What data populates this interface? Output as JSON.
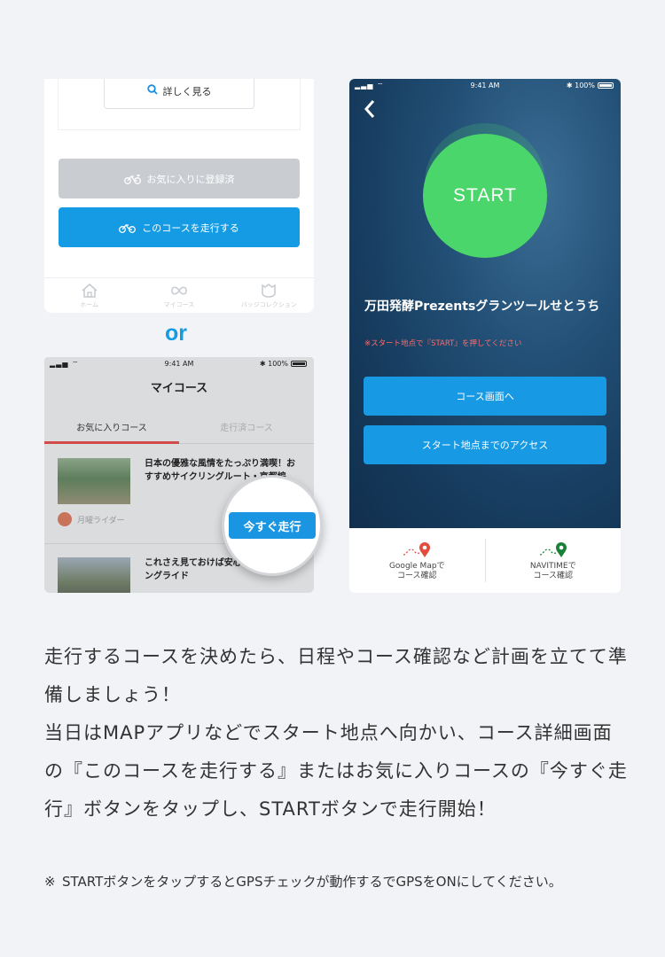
{
  "panel_a": {
    "detail_button": "詳しく見る",
    "fav_button": "お気に入りに登録済",
    "run_button": "このコースを走行する",
    "tabs": [
      "ホーム",
      "マイコース",
      "バッジコレクション"
    ]
  },
  "or_label": "or",
  "panel_b": {
    "status": {
      "time": "9:41 AM",
      "battery": "100%"
    },
    "title": "マイコース",
    "tabs": [
      "お気に入りコース",
      "走行済コース"
    ],
    "items": [
      {
        "title": "日本の優雅な風情をたっぷり満喫！おすすめサイクリングルート・京都編",
        "rider": "月曜ライダー"
      },
      {
        "title": "これさえ見ておけば安心！志賀高原ロングライド"
      }
    ],
    "now_button": "今すぐ走行"
  },
  "panel_c": {
    "status": {
      "time": "9:41 AM",
      "battery": "100%"
    },
    "back_icon": "chevron-left-icon",
    "start_label": "START",
    "course_title": "万田発酵Prezentsグランツールせとうち",
    "course_note": "※スタート地点で『START』を押してください",
    "buttons": [
      "コース画面へ",
      "スタート地点までのアクセス"
    ],
    "footer": [
      {
        "line1": "Google Mapで",
        "line2": "コース確認",
        "color": "#e34b3c"
      },
      {
        "line1": "NAVITIMEで",
        "line2": "コース確認",
        "color": "#1a7f37"
      }
    ]
  },
  "description": {
    "p1": "走行するコースを決めたら、日程やコース確認など計画を立てて準備しましょう！",
    "p2": "当日はMAPアプリなどでスタート地点へ向かい、コース詳細画面の『このコースを走行する』またはお気に入りコースの『今すぐ走行』ボタンをタップし、STARTボタンで走行開始！",
    "note_mark": "※",
    "note": "STARTボタンをタップするとGPSチェックが動作するでGPSをONにしてください。"
  },
  "colors": {
    "accent": "#149be4",
    "start_green": "#4bd66b",
    "hero_bg": "#163b5d",
    "warning": "#ff6a6a"
  }
}
